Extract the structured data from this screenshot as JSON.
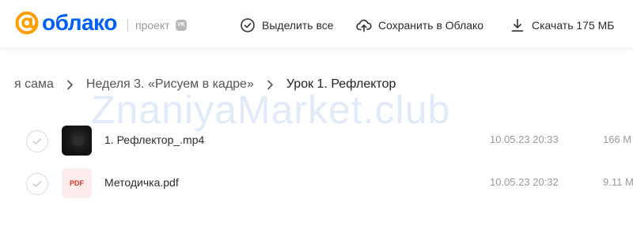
{
  "header": {
    "logo_text": "облако",
    "project_label": "проект",
    "vk_badge": "VK",
    "actions": {
      "select_all": "Выделить все",
      "save_to_cloud": "Сохранить в Облако",
      "download": "Скачать 175 МБ"
    }
  },
  "breadcrumb": {
    "items": [
      "я сама",
      "Неделя 3. «Рисуем в кадре»"
    ],
    "current": "Урок 1. Рефлектор"
  },
  "watermark": "ZnaniyaMarket.club",
  "files": [
    {
      "name": "1. Рефлектор_.mp4",
      "date": "10.05.23 20:33",
      "size": "166 М",
      "type": "video"
    },
    {
      "name": "Методичка.pdf",
      "date": "10.05.23 20:32",
      "size": "9.11 М",
      "type": "pdf",
      "thumb_label": "PDF"
    }
  ],
  "colors": {
    "brand_blue": "#005ff9",
    "brand_orange": "#ff9e00",
    "pdf_red": "#e0352b"
  }
}
